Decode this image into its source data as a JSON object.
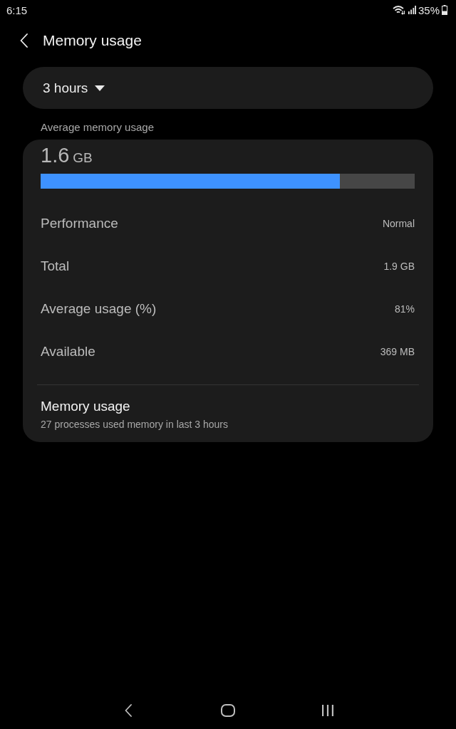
{
  "status_bar": {
    "time": "6:15",
    "battery": "35%"
  },
  "header": {
    "title": "Memory usage"
  },
  "period_dropdown": {
    "value": "3 hours"
  },
  "average": {
    "label": "Average memory usage",
    "value": "1.6",
    "unit": "GB",
    "level": 0.8
  },
  "stats": [
    {
      "label": "Performance",
      "value": "Normal"
    },
    {
      "label": "Total",
      "value": "1.9 GB"
    },
    {
      "label": "Average usage (%)",
      "value": "81%"
    },
    {
      "label": "Available",
      "value": "369 MB"
    }
  ],
  "memory_usage": {
    "title": "Memory usage",
    "subtitle": "27 processes used memory in last 3 hours"
  }
}
